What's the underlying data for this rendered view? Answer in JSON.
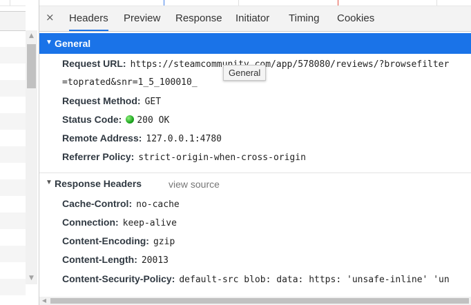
{
  "tabs": {
    "close": "×",
    "items": [
      {
        "label": "Headers"
      },
      {
        "label": "Preview"
      },
      {
        "label": "Response"
      },
      {
        "label": "Initiator"
      },
      {
        "label": "Timing"
      },
      {
        "label": "Cookies"
      }
    ],
    "active": "Headers"
  },
  "general": {
    "title": "General",
    "triangle": "▼",
    "rows": [
      {
        "key": "Request URL:",
        "value": "https://steamcommunity.com/app/578080/reviews/?browsefilter"
      },
      {
        "key": "Request Method:",
        "value": "GET"
      },
      {
        "key": "Status Code:",
        "value": "200 OK"
      },
      {
        "key": "Remote Address:",
        "value": "127.0.0.1:4780"
      },
      {
        "key": "Referrer Policy:",
        "value": "strict-origin-when-cross-origin"
      }
    ],
    "url_continuation": "=toprated&snr=1_5_100010_"
  },
  "tooltip": {
    "text": "General"
  },
  "response_headers": {
    "title": "Response Headers",
    "triangle": "▼",
    "view_source": "view source",
    "rows": [
      {
        "key": "Cache-Control:",
        "value": "no-cache"
      },
      {
        "key": "Connection:",
        "value": "keep-alive"
      },
      {
        "key": "Content-Encoding:",
        "value": "gzip"
      },
      {
        "key": "Content-Length:",
        "value": "20013"
      },
      {
        "key": "Content-Security-Policy:",
        "value": "default-src blob: data: https: 'unsafe-inline' 'un"
      }
    ]
  },
  "scrollbar": {
    "up": "▲",
    "down": "▼",
    "left": "◀"
  },
  "colors": {
    "accent": "#1a73e8",
    "status_ok": "#16a01a"
  }
}
